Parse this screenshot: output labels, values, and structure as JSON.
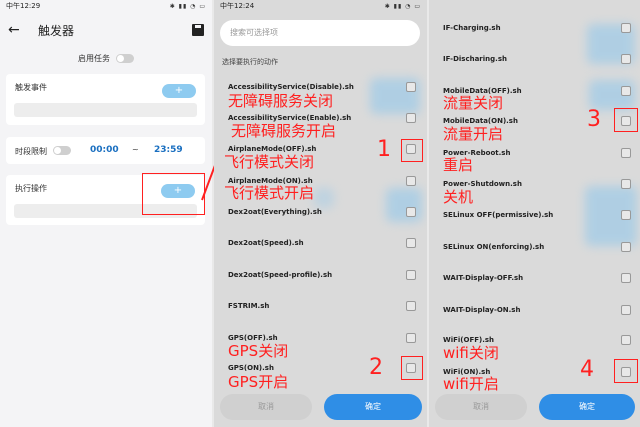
{
  "panel1": {
    "status_time": "中午12:29",
    "title": "触发器",
    "enable_label": "启用任务",
    "trigger_label": "触发事件",
    "time_limit_label": "时段限制",
    "start_time": "00:00",
    "time_sep": "~",
    "end_time": "23:59",
    "action_label": "执行操作",
    "plus": "+"
  },
  "panel2": {
    "status_time": "中午12:24",
    "search_placeholder": "搜索可选择项",
    "section_label": "选择要执行的动作",
    "items": [
      {
        "label": "AccessibilityService(Disable).sh",
        "anno": "无障碍服务关闭"
      },
      {
        "label": "AccessibilityService(Enable).sh",
        "anno": "无障碍服务开启"
      },
      {
        "label": "AirplaneMode(OFF).sh",
        "anno": "飞行模式关闭"
      },
      {
        "label": "AirplaneMode(ON).sh",
        "anno": "飞行模式开启"
      },
      {
        "label": "Dex2oat(Everything).sh",
        "anno": ""
      },
      {
        "label": "Dex2oat(Speed).sh",
        "anno": ""
      },
      {
        "label": "Dex2oat(Speed-profile).sh",
        "anno": ""
      },
      {
        "label": "FSTRIM.sh",
        "anno": ""
      },
      {
        "label": "GPS(OFF).sh",
        "anno": "GPS关闭"
      },
      {
        "label": "GPS(ON).sh",
        "anno": "GPS开启"
      }
    ],
    "num1": "1",
    "num2": "2",
    "cancel": "取消",
    "ok": "确定"
  },
  "panel3": {
    "items": [
      {
        "label": "IF-Charging.sh",
        "anno": ""
      },
      {
        "label": "IF-Discharing.sh",
        "anno": ""
      },
      {
        "label": "MobileData(OFF).sh",
        "anno": "流量关闭"
      },
      {
        "label": "MobileData(ON).sh",
        "anno": "流量开启"
      },
      {
        "label": "Power-Reboot.sh",
        "anno": "重启"
      },
      {
        "label": "Power-Shutdown.sh",
        "anno": "关机"
      },
      {
        "label": "SELinux OFF(permissive).sh",
        "anno": ""
      },
      {
        "label": "SELinux ON(enforcing).sh",
        "anno": ""
      },
      {
        "label": "WAIT-Display-OFF.sh",
        "anno": ""
      },
      {
        "label": "WAIT-Display-ON.sh",
        "anno": ""
      },
      {
        "label": "WiFi(OFF).sh",
        "anno": "wifi关闭"
      },
      {
        "label": "WiFi(ON).sh",
        "anno": "wifi开启"
      }
    ],
    "num3": "3",
    "num4": "4",
    "cancel": "取消",
    "ok": "确定"
  },
  "colors": {
    "accent": "#2f8ee6",
    "annotation": "#ff2020",
    "plus_button": "#8ecbf0"
  }
}
